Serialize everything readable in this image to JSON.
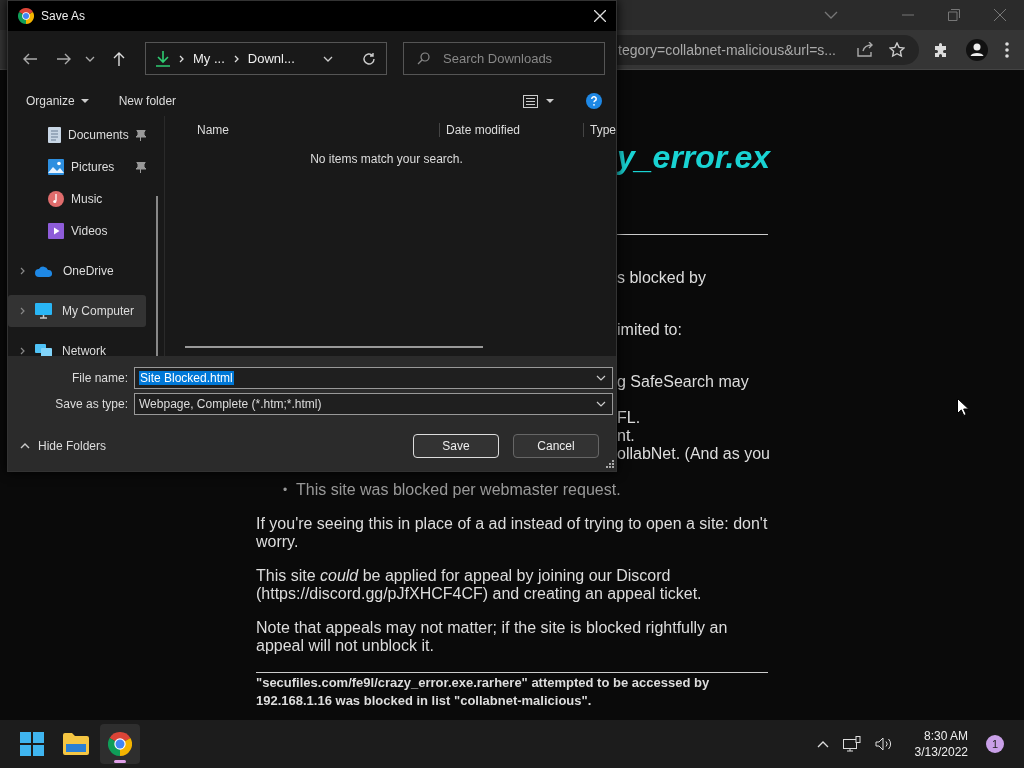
{
  "browser": {
    "address": "tegory=collabnet-malicious&url=s..."
  },
  "page": {
    "heading": "y_error.ex",
    "fragments": [
      "s blocked by",
      "imited to:",
      "g SafeSearch may",
      "FL.",
      "nt.",
      "ollabNet. (And as you"
    ],
    "list": [
      {
        "bullet": "•",
        "text": "This site was blocked per webmaster request."
      }
    ],
    "paragraphs": [
      "If you're seeing this in place of a ad instead of trying to open a site: don't worry.",
      "This site *could* be applied for appeal by joining our Discord (https://discord.gg/pJfXHCF4CF) and creating an appeal ticket.",
      "Note that appeals may not matter; if the site is blocked rightfully an appeal will not unblock it."
    ],
    "footer": "\"secufiles.com/fe9l/crazy_error.exe.rarhere\" attempted to be accessed by 192.168.1.16 was blocked in list \"collabnet-malicious\"."
  },
  "dialog": {
    "title": "Save As",
    "path": [
      "My ...",
      "Downl..."
    ],
    "search_placeholder": "Search Downloads",
    "commands": [
      {
        "label": "Organize",
        "dropdown": true
      },
      {
        "label": "New folder",
        "dropdown": false
      }
    ],
    "sidebar": [
      {
        "label": "Documents",
        "kind": "documents",
        "pinned": true,
        "expandable": false,
        "selected": false
      },
      {
        "label": "Pictures",
        "kind": "pictures",
        "pinned": true,
        "expandable": false,
        "selected": false
      },
      {
        "label": "Music",
        "kind": "music",
        "pinned": false,
        "expandable": false,
        "selected": false
      },
      {
        "label": "Videos",
        "kind": "videos",
        "pinned": false,
        "expandable": false,
        "selected": false
      },
      {
        "label": "OneDrive",
        "kind": "cloud",
        "pinned": false,
        "expandable": true,
        "selected": false
      },
      {
        "label": "My Computer",
        "kind": "computer",
        "pinned": false,
        "expandable": true,
        "selected": true
      },
      {
        "label": "Network",
        "kind": "network",
        "pinned": false,
        "expandable": true,
        "selected": false
      }
    ],
    "columns": [
      "Name",
      "Date modified",
      "Type"
    ],
    "empty_message": "No items match your search.",
    "file_name_label": "File name:",
    "file_name": "Site Blocked.html",
    "file_name_selected": true,
    "type_label": "Save as type:",
    "type_value": "Webpage, Complete (*.htm;*.html)",
    "hide_folders": "Hide Folders",
    "buttons": [
      {
        "label": "Save",
        "default": true
      },
      {
        "label": "Cancel",
        "default": false
      }
    ]
  },
  "taskbar": {
    "apps": [
      {
        "kind": "start",
        "active": false
      },
      {
        "kind": "folder",
        "active": false
      },
      {
        "kind": "chrome",
        "active": true
      }
    ],
    "time": "8:30 AM",
    "date": "3/13/2022",
    "notifications": "1"
  }
}
